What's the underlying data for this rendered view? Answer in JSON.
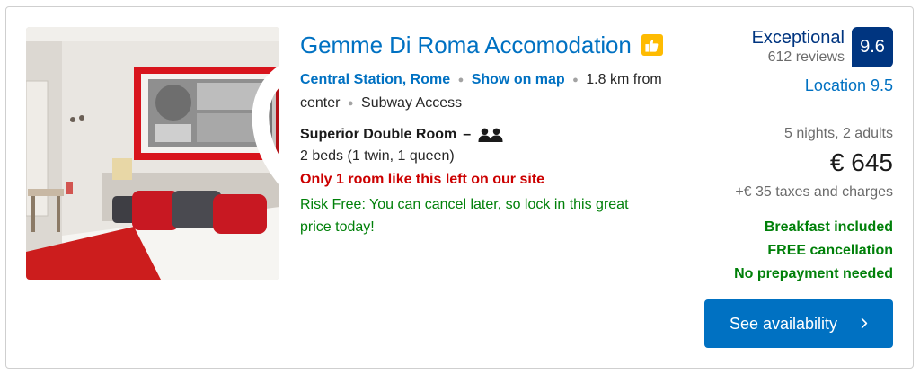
{
  "property": {
    "name": "Gemme Di Roma Accomodation",
    "photo_icon": "hotel-room-photo",
    "favorite_icon": "heart-icon",
    "recommended_icon": "thumbs-up-icon"
  },
  "location": {
    "area_link": "Central Station, Rome",
    "map_link": "Show on map",
    "distance": "1.8 km from center",
    "transit": "Subway Access"
  },
  "room": {
    "name": "Superior Double Room",
    "occupancy_icon": "two-adults-icon",
    "beds": "2 beds (1 twin, 1 queen)",
    "scarcity": "Only 1 room like this left on our site",
    "risk_free": "Risk Free: You can cancel later, so lock in this great price today!"
  },
  "review": {
    "word": "Exceptional",
    "count": "612 reviews",
    "score": "9.6",
    "location_score": "Location 9.5"
  },
  "pricing": {
    "stay": "5 nights, 2 adults",
    "price": "€ 645",
    "taxes": "+€ 35 taxes and charges"
  },
  "perks": [
    "Breakfast included",
    "FREE cancellation",
    "No prepayment needed"
  ],
  "cta": {
    "label": "See availability",
    "icon": "chevron-right-icon"
  },
  "colors": {
    "link": "#0071c2",
    "brand_dark": "#003580",
    "positive": "#008009",
    "urgent": "#cc0000",
    "badge_yellow": "#febb02"
  }
}
